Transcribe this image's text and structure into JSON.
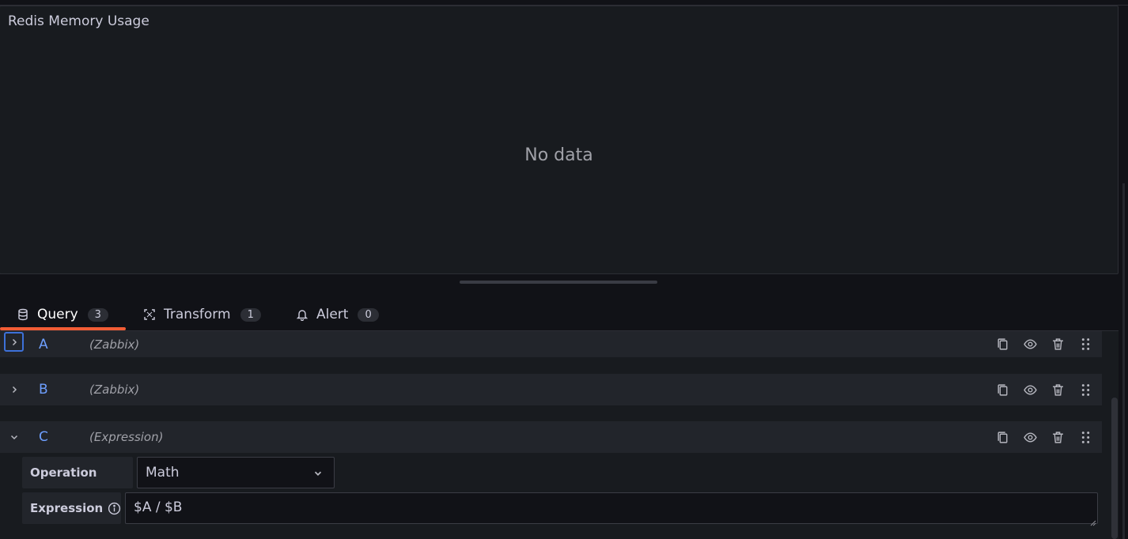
{
  "panel": {
    "title": "Redis Memory Usage",
    "empty_message": "No data"
  },
  "tabs": [
    {
      "label": "Query",
      "count": "3",
      "icon": "database-icon",
      "active": true
    },
    {
      "label": "Transform",
      "count": "1",
      "icon": "transform-icon",
      "active": false
    },
    {
      "label": "Alert",
      "count": "0",
      "icon": "bell-icon",
      "active": false
    }
  ],
  "colors": {
    "accent_tab": "#f15c35",
    "query_letter": "#6e9fff",
    "focus": "#3d71d9"
  },
  "queries": [
    {
      "ref": "A",
      "datasource": "(Zabbix)",
      "expanded": false
    },
    {
      "ref": "B",
      "datasource": "(Zabbix)",
      "expanded": false
    },
    {
      "ref": "C",
      "datasource": "(Expression)",
      "expanded": true
    }
  ],
  "expression_editor": {
    "operation_label": "Operation",
    "operation_value": "Math",
    "expression_label": "Expression",
    "expression_value": "$A / $B"
  },
  "actions": [
    "copy-icon",
    "eye-icon",
    "trash-icon",
    "drag-handle-icon"
  ]
}
